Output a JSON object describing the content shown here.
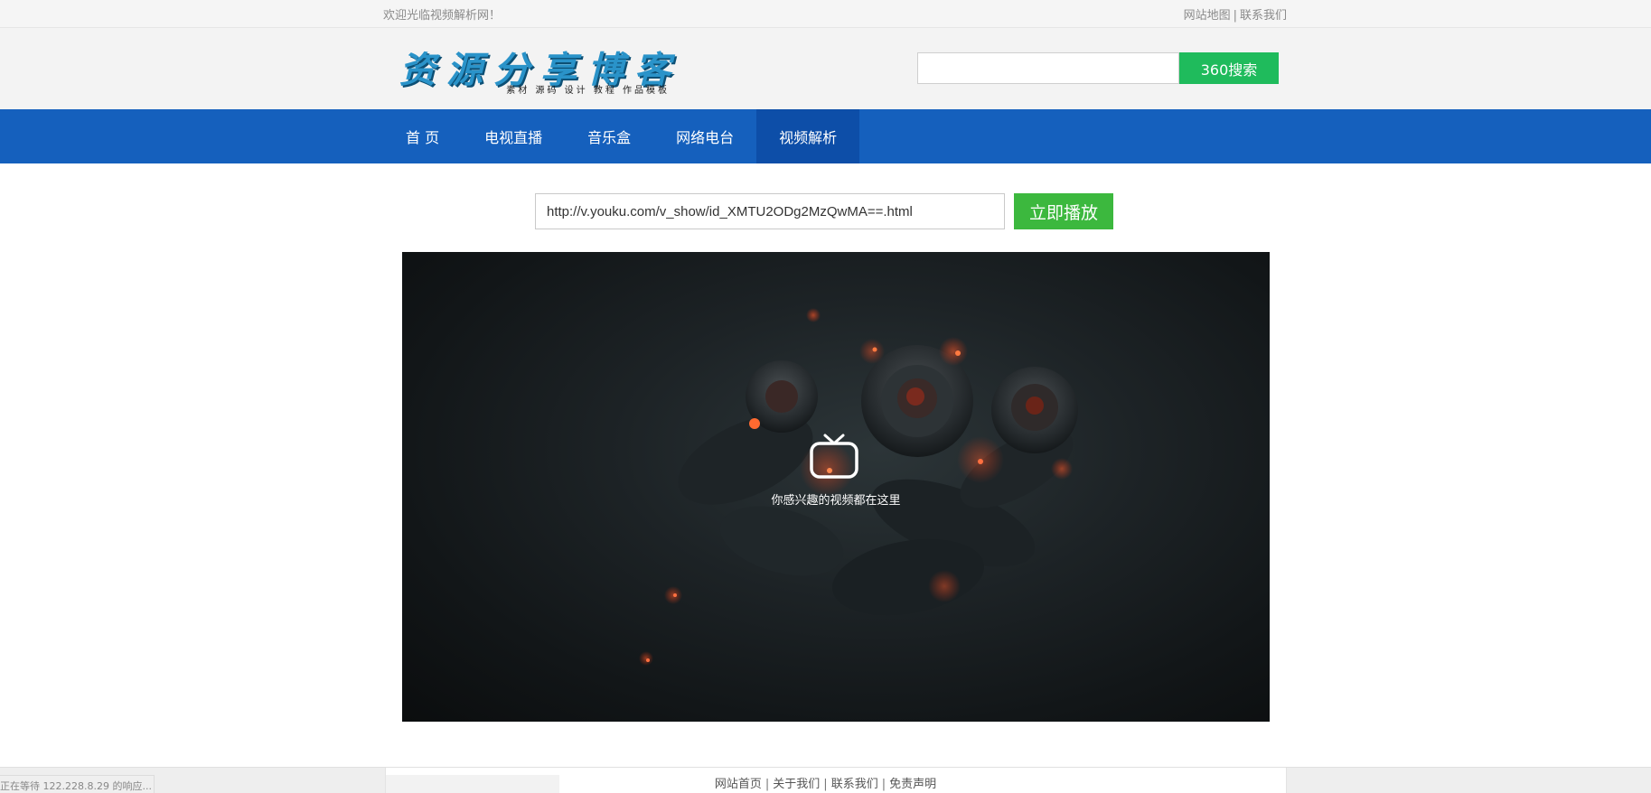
{
  "topbar": {
    "welcome": "欢迎光临视频解析网！",
    "sitemap": "网站地图",
    "separator": "|",
    "contact": "联系我们"
  },
  "logo": {
    "title": "资源分享博客",
    "subtitle": "素材 源码 设计 教程 作品模板"
  },
  "search": {
    "value": "",
    "button": "360搜索"
  },
  "nav": {
    "items": [
      {
        "label": "首 页",
        "active": false
      },
      {
        "label": "电视直播",
        "active": false
      },
      {
        "label": "音乐盒",
        "active": false
      },
      {
        "label": "网络电台",
        "active": false
      },
      {
        "label": "视频解析",
        "active": true
      }
    ]
  },
  "parser": {
    "url": "http://v.youku.com/v_show/id_XMTU2ODg2MzQwMA==.html",
    "button": "立即播放"
  },
  "player": {
    "icon": "tv-icon",
    "message": "你感兴趣的视频都在这里"
  },
  "footer": {
    "links": [
      "网站首页",
      "关于我们",
      "联系我们",
      "免责声明"
    ],
    "separator": "|"
  },
  "statusbar": {
    "text": "正在等待 122.228.8.29 的响应..."
  },
  "colors": {
    "nav": "#1560bd",
    "nav_active": "#0d4ea8",
    "search_button": "#1fbb5c",
    "play_button": "#3cb83e"
  }
}
